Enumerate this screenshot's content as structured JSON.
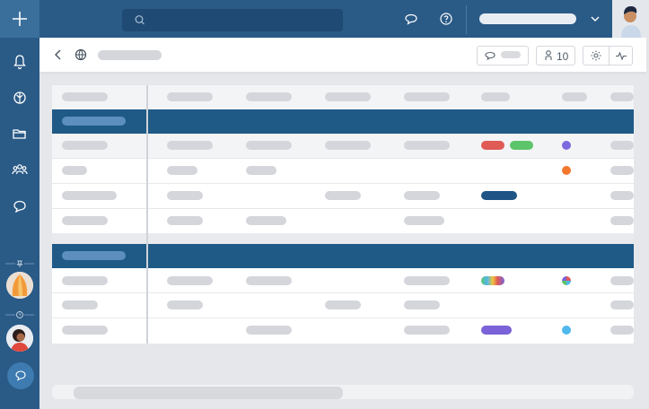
{
  "sidebar": {
    "items": [
      {
        "icon": "plus-icon"
      },
      {
        "icon": "bell-icon"
      },
      {
        "icon": "globe-icon"
      },
      {
        "icon": "folder-icon"
      },
      {
        "icon": "users-icon"
      },
      {
        "icon": "chat-icon"
      }
    ],
    "pinned_icon": "pin-icon",
    "recent_icon": "clock-icon",
    "bottom_icon": "chat-bubble-icon"
  },
  "topbar": {
    "search_icon": "search-icon",
    "messages_icon": "messages-icon",
    "help_icon": "help-icon",
    "workspace_chevron": "chevron-down-icon"
  },
  "header": {
    "back_icon": "chevron-left-icon",
    "globe_icon": "globe-icon",
    "comments_icon": "comment-icon",
    "members_count": "10",
    "members_icon": "person-icon",
    "settings_icon": "gear-icon",
    "activity_icon": "activity-icon"
  },
  "colors": {
    "sidebar": "#2a5a86",
    "group_header": "#1f5a87",
    "tag_red": "#e05a56",
    "tag_green": "#5cc46a",
    "tag_navy": "#1d5587",
    "tag_purple": "#7b62d8",
    "dot_purple": "#7e6ae0",
    "dot_orange": "#f2782f",
    "dot_blue": "#4fb8ec"
  }
}
